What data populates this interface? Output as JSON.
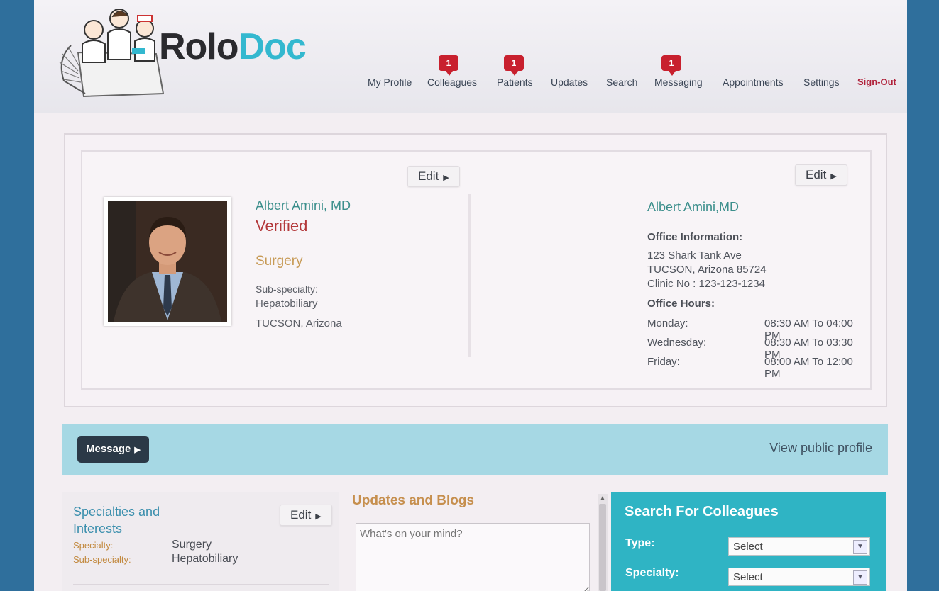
{
  "brand": {
    "part1": "Rolo",
    "part2": "Doc"
  },
  "nav": [
    {
      "label": "My Profile",
      "badge": null
    },
    {
      "label": "Colleagues",
      "badge": "1"
    },
    {
      "label": "Patients",
      "badge": "1"
    },
    {
      "label": "Updates",
      "badge": null
    },
    {
      "label": "Search",
      "badge": null
    },
    {
      "label": "Messaging",
      "badge": "1"
    },
    {
      "label": "Appointments",
      "badge": null
    },
    {
      "label": "Settings",
      "badge": null
    },
    {
      "label": "Sign-Out",
      "badge": null
    }
  ],
  "profile": {
    "edit_label": "Edit",
    "name": "Albert Amini, MD",
    "status": "Verified",
    "specialty": "Surgery",
    "subspecialty_label": "Sub-specialty:",
    "subspecialty": "Hepatobiliary",
    "location": "TUCSON, Arizona"
  },
  "office": {
    "edit_label": "Edit",
    "name": "Albert Amini,MD",
    "info_heading": "Office Information:",
    "address1": "123 Shark Tank Ave",
    "address2": "TUCSON, Arizona 85724",
    "clinic": "Clinic No : 123-123-1234",
    "hours_heading": "Office Hours:",
    "hours": [
      {
        "day": "Monday:",
        "time": "08:30 AM To 04:00 PM"
      },
      {
        "day": "Wednesday:",
        "time": "08:30 AM To 03:30 PM"
      },
      {
        "day": "Friday:",
        "time": "08:00 AM To 12:00 PM"
      }
    ]
  },
  "actions": {
    "message_label": "Message",
    "public_profile_label": "View public profile"
  },
  "specialties": {
    "title": "Specialties and Interests",
    "edit_label": "Edit",
    "specialty_label": "Specialty:",
    "specialty_value": "Surgery",
    "subspecialty_label": "Sub-specialty:",
    "subspecialty_value": "Hepatobiliary"
  },
  "updates": {
    "title": "Updates and Blogs",
    "placeholder": "What's on your mind?"
  },
  "search": {
    "title": "Search For Colleagues",
    "type_label": "Type:",
    "type_value": "Select",
    "specialty_label": "Specialty:",
    "specialty_value": "Select"
  },
  "colors": {
    "brand_teal": "#33b8cf",
    "badge_red": "#c8202e",
    "signout_red": "#b0213a",
    "search_bg": "#2fb4c4"
  }
}
